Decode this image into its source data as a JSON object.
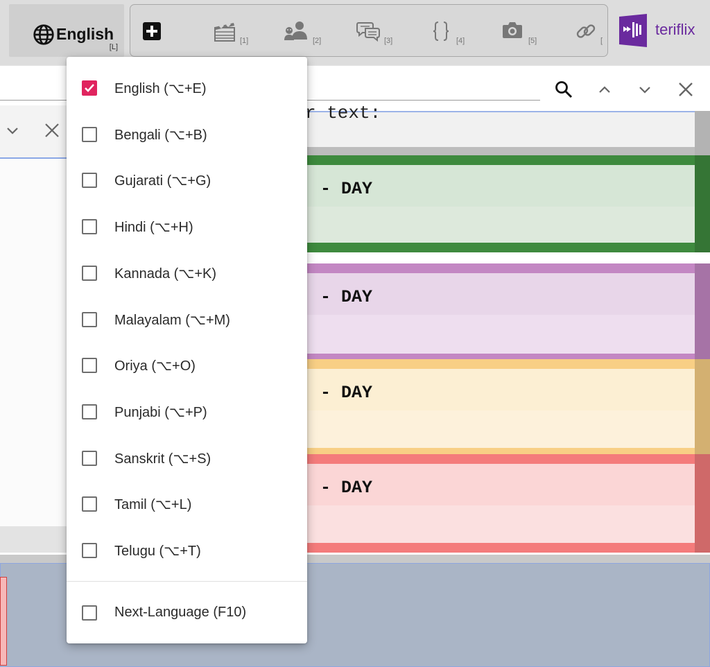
{
  "toolbar": {
    "language_button": {
      "label": "English",
      "shortcut": "[L]"
    },
    "tools": [
      {
        "icon": "add-icon",
        "shortcut": ""
      },
      {
        "icon": "clapperboard-icon",
        "shortcut": "[1]"
      },
      {
        "icon": "speakers-icon",
        "shortcut": "[2]"
      },
      {
        "icon": "speech-bubbles-icon",
        "shortcut": "[3]"
      },
      {
        "icon": "braces-icon",
        "shortcut": "[4]"
      },
      {
        "icon": "camera-icon",
        "shortcut": "[5]"
      },
      {
        "icon": "link-icon",
        "shortcut": "["
      }
    ]
  },
  "logo": {
    "name": "teriflix",
    "color": "#6a2a9e"
  },
  "find_bar": {
    "icons": [
      "search-icon",
      "chevron-up-icon",
      "chevron-down-icon",
      "close-icon"
    ]
  },
  "left_panel": {
    "icons": [
      "chevron-down-icon",
      "close-icon"
    ]
  },
  "content": {
    "top_strip_text": "r text:",
    "blocks": [
      {
        "label": "- DAY",
        "color": "#3e8a3e",
        "light": "#d6e6d6",
        "light2": "#dde9dc"
      },
      {
        "label": "- DAY",
        "color": "#c387c3",
        "light": "#e8d6e9",
        "light2": "#eedeef"
      },
      {
        "label": "- DAY",
        "color": "#f8cf85",
        "light": "#fcefd3",
        "light2": "#fdf1db"
      },
      {
        "label": "- DAY",
        "color": "#f47b7b",
        "light": "#fbd6d6",
        "light2": "#fbe0e0"
      }
    ]
  },
  "language_menu": {
    "items": [
      {
        "label": "English (⌥+E)",
        "checked": true
      },
      {
        "label": "Bengali (⌥+B)",
        "checked": false
      },
      {
        "label": "Gujarati (⌥+G)",
        "checked": false
      },
      {
        "label": "Hindi (⌥+H)",
        "checked": false
      },
      {
        "label": "Kannada (⌥+K)",
        "checked": false
      },
      {
        "label": "Malayalam (⌥+M)",
        "checked": false
      },
      {
        "label": "Oriya (⌥+O)",
        "checked": false
      },
      {
        "label": "Punjabi (⌥+P)",
        "checked": false
      },
      {
        "label": "Sanskrit (⌥+S)",
        "checked": false
      },
      {
        "label": "Tamil (⌥+L)",
        "checked": false
      },
      {
        "label": "Telugu (⌥+T)",
        "checked": false
      }
    ],
    "next_item": {
      "label": "Next-Language (F10)",
      "checked": false
    },
    "accent": "#e0245e"
  }
}
